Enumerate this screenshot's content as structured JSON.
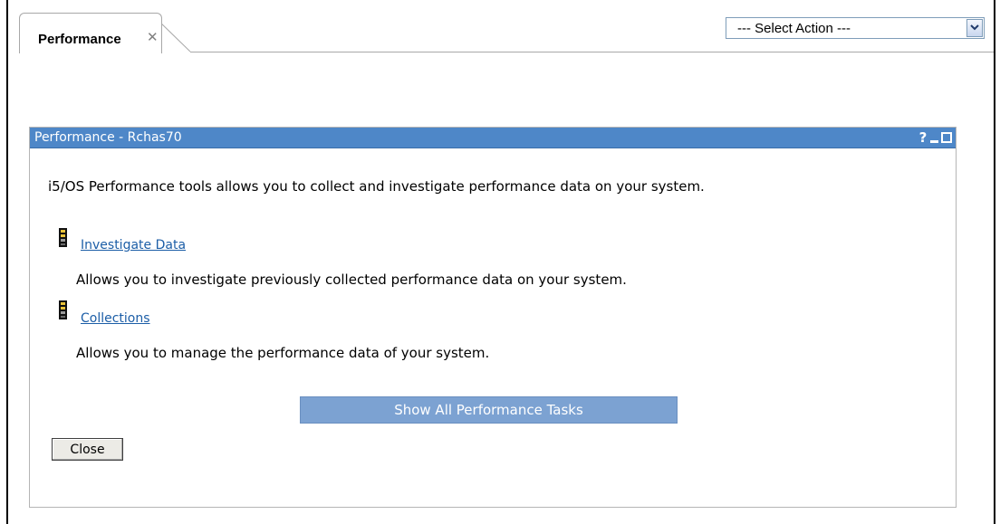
{
  "tab": {
    "label": "Performance",
    "close_glyph": "✕"
  },
  "action_select": {
    "selected": "--- Select Action ---"
  },
  "portlet": {
    "title": "Performance - Rchas70",
    "controls": {
      "help": "?",
      "minimize_icon": "minimize-icon",
      "maximize_icon": "maximize-icon"
    },
    "intro": "i5/OS Performance tools allows you to collect and investigate performance data on your system.",
    "tasks": [
      {
        "label": "Investigate Data",
        "description": "Allows you to investigate previously collected performance data on your system.",
        "icon": "task-icon"
      },
      {
        "label": "Collections",
        "description": "Allows you to manage the performance data of your system.",
        "icon": "task-icon"
      }
    ],
    "show_all_label": "Show All Performance Tasks",
    "close_label": "Close"
  },
  "colors": {
    "titlebar": "#4e87c8",
    "link": "#1c5ea7",
    "show_all_button": "#7ca2d2"
  }
}
